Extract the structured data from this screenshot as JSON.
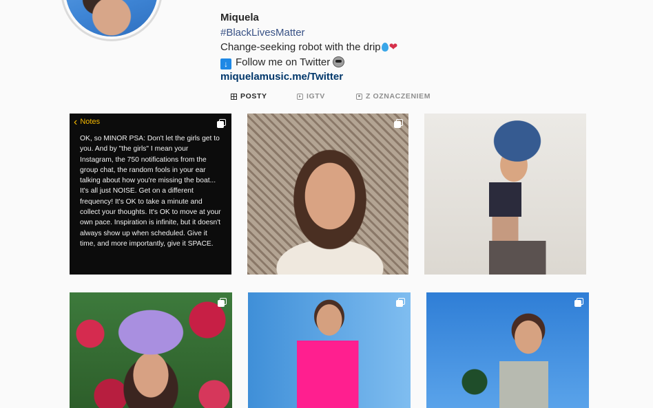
{
  "profile": {
    "name": "Miquela",
    "hashtag": "#BlackLivesMatter",
    "bio_line1": "Change-seeking robot with the drip",
    "bio_line2": "Follow me on Twitter",
    "link": "miquelamusic.me/Twitter",
    "emojis": [
      "droplet-icon",
      "broken-heart-icon",
      "down-arrow-icon",
      "robot-face-icon"
    ]
  },
  "tabs": [
    {
      "label": "POSTY",
      "icon": "grid-icon",
      "active": true
    },
    {
      "label": "IGTV",
      "icon": "igtv-icon",
      "active": false
    },
    {
      "label": "Z OZNACZENIEM",
      "icon": "tagged-icon",
      "active": false
    }
  ],
  "posts": [
    {
      "type": "notes",
      "multi": true,
      "notes_header": "Notes",
      "notes_text": "OK, so MINOR PSA: Don't let the girls get to you. And by \"the girls\" I mean your Instagram, the 750 notifications from the group chat, the random fools in your ear talking about how you're missing the boat... It's all just NOISE. Get on a different frequency! It's OK to take a minute and collect your thoughts. It's OK to move at your own pace. Inspiration is infinite, but it doesn't always show up when scheduled. Give it time, and more importantly, give it SPACE."
    },
    {
      "type": "photo",
      "multi": true
    },
    {
      "type": "photo",
      "multi": false
    },
    {
      "type": "photo",
      "multi": true
    },
    {
      "type": "photo",
      "multi": true
    },
    {
      "type": "photo",
      "multi": true
    }
  ],
  "colors": {
    "background": "#fafafa",
    "hashtag": "#385185",
    "link": "#00376b",
    "notes_accent": "#f5b900"
  }
}
